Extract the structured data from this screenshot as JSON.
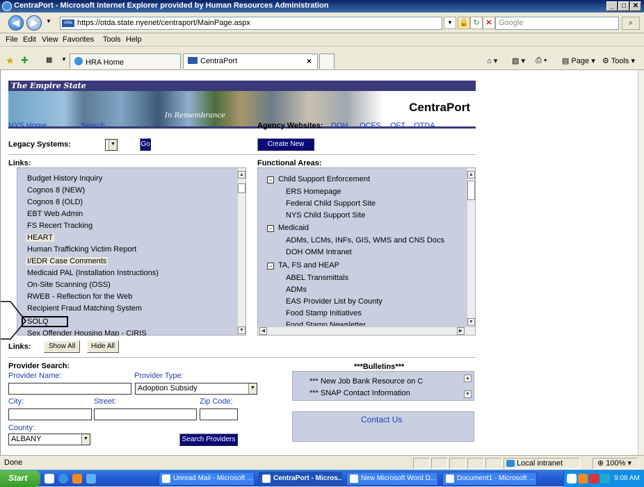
{
  "window": {
    "title": "CentraPort - Microsoft Internet Explorer provided by Human Resources Administration"
  },
  "browser": {
    "url": "https://otda.state.nyenet/centraport/MainPage.aspx",
    "search_placeholder": "Google",
    "menu": [
      "File",
      "Edit",
      "View",
      "Favorites",
      "Tools",
      "Help"
    ],
    "tabs": [
      {
        "label": "HRA Home"
      },
      {
        "label": "CentraPort"
      }
    ],
    "tab_close": "×",
    "page_cmd": "Page",
    "tools_cmd": "Tools",
    "status_text": "Done",
    "zone": "Local intranet",
    "zoom": "100%"
  },
  "banner": {
    "slogan": "The Empire State",
    "watermark": "In Remembrance",
    "brand": "CentraPort"
  },
  "topnav": {
    "nys_home": "NYS Home",
    "search": "Search",
    "agency_label": "Agency Websites:",
    "agencies": [
      "DOH",
      "OCFS",
      "OFT",
      "OTDA"
    ]
  },
  "legacy": {
    "label": "Legacy Systems:",
    "go": "Go",
    "create_email": "Create New Email"
  },
  "links": {
    "header": "Links:",
    "items": [
      "Budget History Inquiry",
      "Cognos 8 (NEW)",
      "Cognos 8 (OLD)",
      "EBT Web Admin",
      "FS Recert Tracking",
      "HEART",
      "Human Trafficking Victim Report",
      "I/EDR Case Comments",
      "Medicaid PAL (Installation Instructions)",
      "On-Site Scanning (OSS)",
      "RWEB - Reflection for the Web",
      "Recipient Fraud Matching System",
      "SOLQ",
      "Sex Offender Housing Map - CIRIS"
    ],
    "footer_label": "Links:",
    "show_all": "Show All",
    "hide_all": "Hide All"
  },
  "functional": {
    "header": "Functional Areas:",
    "groups": [
      {
        "name": "Child Support Enforcement",
        "items": [
          "ERS Homepage",
          "Federal Child Support Site",
          "NYS Child Support Site"
        ]
      },
      {
        "name": "Medicaid",
        "items": [
          "ADMs, LCMs, INFs, GIS, WMS and CNS Docs",
          "DOH OMM Intranet"
        ]
      },
      {
        "name": "TA, FS and HEAP",
        "items": [
          "ABEL Transmittals",
          "ADMs",
          "EAS Provider List by County",
          "Food Stamp Initiatives",
          "Food Stamp Newsletter"
        ]
      }
    ]
  },
  "provider": {
    "header": "Provider Search:",
    "name_label": "Provider Name:",
    "type_label": "Provider Type:",
    "type_value": "Adoption Subsidy",
    "city_label": "City:",
    "street_label": "Street:",
    "zip_label": "Zip Code:",
    "county_label": "County:",
    "county_value": "ALBANY",
    "search_btn": "Search Providers"
  },
  "bulletins": {
    "header": "***Bulletins***",
    "items": [
      "*** New Job Bank Resource on C",
      "*** SNAP Contact Information"
    ],
    "contact": "Contact Us"
  },
  "taskbar": {
    "start": "Start",
    "tasks": [
      "Unread Mail - Microsoft ...",
      "CentraPort - Micros...",
      "New Microsoft Word D...",
      "Document1 - Microsoft ..."
    ],
    "clock": "9:08 AM"
  }
}
